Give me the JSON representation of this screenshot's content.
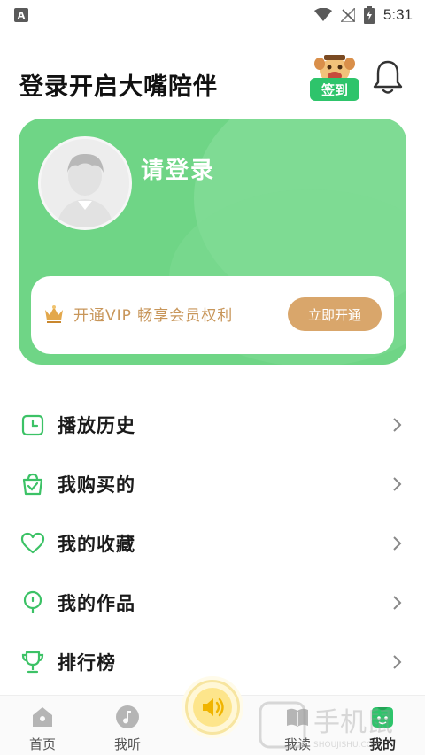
{
  "status_bar": {
    "notification_badge": "A",
    "time": "5:31",
    "icons": [
      "wifi-icon",
      "no-signal-icon",
      "battery-charging-icon"
    ]
  },
  "header": {
    "title": "登录开启大嘴陪伴",
    "signin_label": "签到"
  },
  "profile_card": {
    "login_prompt": "请登录",
    "vip_text": "开通VIP 畅享会员权利",
    "vip_button": "立即开通"
  },
  "menu": {
    "items": [
      {
        "label": "播放历史",
        "icon": "history-icon"
      },
      {
        "label": "我购买的",
        "icon": "shopping-bag-icon"
      },
      {
        "label": "我的收藏",
        "icon": "heart-icon"
      },
      {
        "label": "我的作品",
        "icon": "microphone-icon"
      },
      {
        "label": "排行榜",
        "icon": "trophy-icon"
      }
    ]
  },
  "bottom_nav": {
    "items": [
      {
        "label": "首页",
        "icon": "home-icon"
      },
      {
        "label": "我听",
        "icon": "music-note-icon"
      },
      {
        "label": "我读",
        "icon": "read-icon"
      },
      {
        "label": "我的",
        "icon": "profile-icon"
      }
    ],
    "active": "我的",
    "play_icon": "speaker-icon"
  },
  "watermark": {
    "text": "手机鼠",
    "subtext": "SHOUJISHU.COM"
  },
  "colors": {
    "brand_green": "#2ec46b",
    "card_green": "#6fd586",
    "vip_gold": "#d9a66b",
    "icon_green": "#3cc266"
  }
}
